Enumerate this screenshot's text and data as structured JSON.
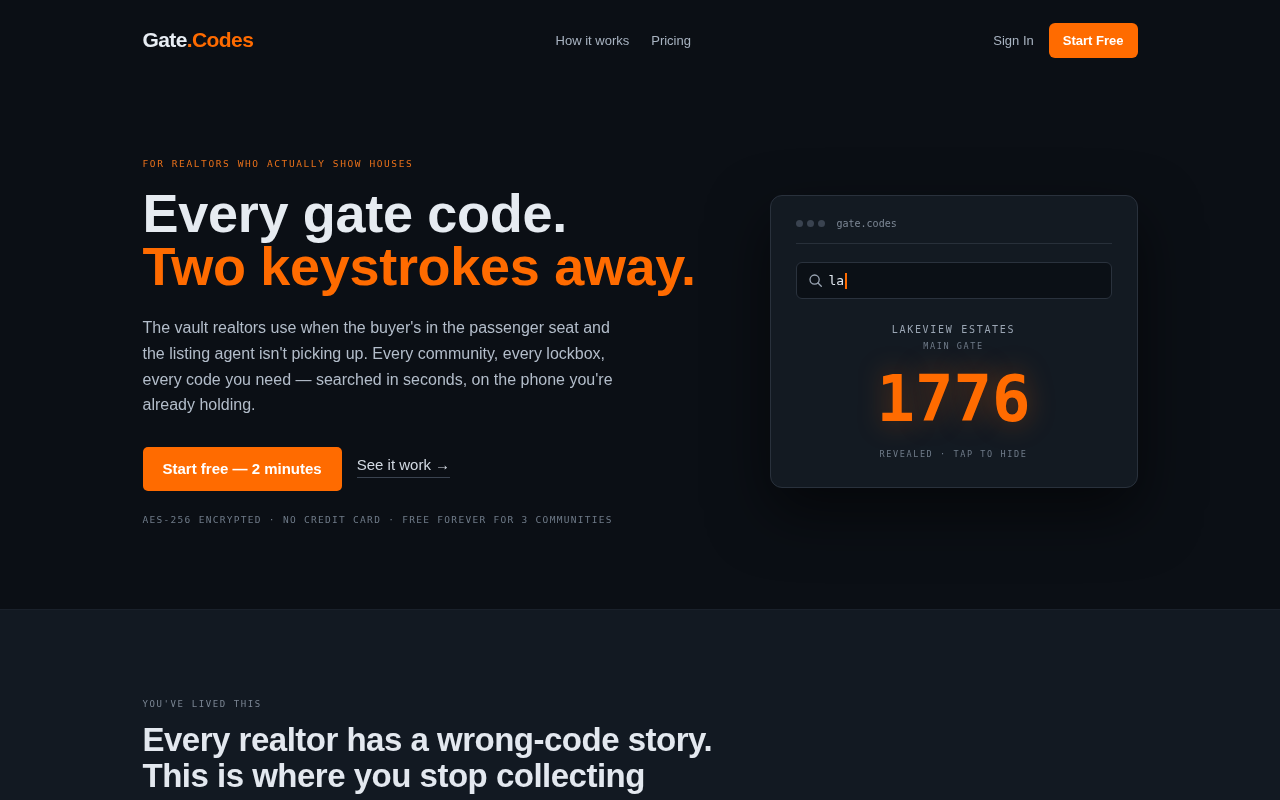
{
  "nav": {
    "logo": {
      "text": "Gate",
      "accent": ".Codes"
    },
    "links": [
      {
        "label": "How it works"
      },
      {
        "label": "Pricing"
      }
    ],
    "actions": [
      {
        "label": "Sign In",
        "kind": "link"
      },
      {
        "label": "Start Free",
        "kind": "primary"
      }
    ]
  },
  "hero": {
    "eyebrow": "FOR REALTORS WHO ACTUALLY SHOW HOUSES",
    "headline": "Every gate code.",
    "headline_accent": "Two keystrokes away.",
    "body": "The vault realtors use when the buyer's in the passenger seat and the listing agent isn't picking up. Every community, every lockbox, every code you need — searched in seconds, on the phone you're already holding.",
    "buttons": [
      {
        "label": "Start free — 2 minutes",
        "kind": "primary"
      },
      {
        "label": "See it work →",
        "kind": "link"
      }
    ],
    "trust_line": "AES-256 ENCRYPTED · NO CREDIT CARD · FREE FOREVER FOR 3 COMMUNITIES"
  },
  "demo_card": {
    "address": "gate.codes",
    "search": {
      "value": "la",
      "focused": true
    },
    "community": "LAKEVIEW ESTATES",
    "gate": "MAIN GATE",
    "code": "1776",
    "status": "REVEALED · TAP TO HIDE"
  },
  "story": {
    "eyebrow": "YOU'VE LIVED THIS",
    "headline": "Every realtor has a wrong-code story. This is where you stop collecting"
  }
}
